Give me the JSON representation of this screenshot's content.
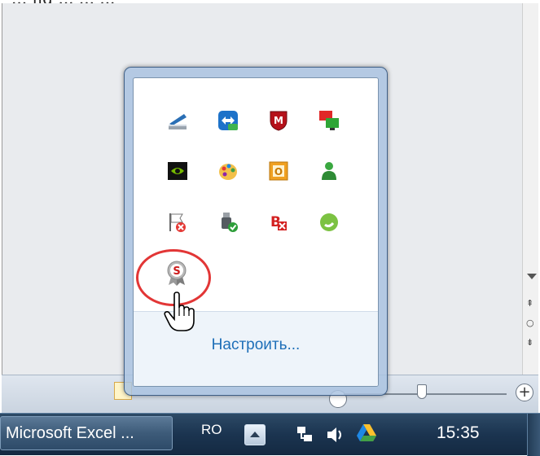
{
  "caption_top": "... ng ... ... ...",
  "popup": {
    "customize_label": "Настроить...",
    "icons": [
      "scanner-icon",
      "teamviewer-icon",
      "mcafee-icon",
      "network-monitor-icon",
      "nvidia-icon",
      "paint-palette-icon",
      "outlook-icon",
      "user-icon",
      "action-center-flag-icon",
      "usb-safe-remove-icon",
      "xps-icon",
      "skype-icon",
      "security-seal-icon"
    ]
  },
  "statusbar": {
    "zoom_plus": "+"
  },
  "taskbar": {
    "app_button": "Microsoft Excel ...",
    "language": "RO",
    "clock": "15:35"
  },
  "colors": {
    "highlight": "#e23636",
    "link": "#1e6fb8",
    "taskbar": "#1b3450"
  }
}
